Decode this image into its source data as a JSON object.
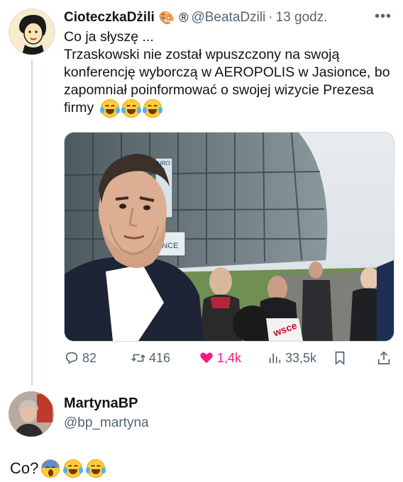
{
  "tweet": {
    "author_name": "CioteczkaDżili",
    "author_badges": [
      "🎨",
      "®"
    ],
    "handle": "@BeataDzili",
    "separator": "·",
    "time": "13 godz.",
    "more_icon": "more-dots-icon",
    "text": "Co ja słyszę ...\nTrzaskowski nie został wpuszczony na swoją konferencję wyborczą w AEROPOLIS w Jasionce, bo zapomniał poinformować o swojej wizycie Prezesa firmy",
    "text_emojis": [
      "😂",
      "😂",
      "😂"
    ],
    "media": {
      "sign_top": "URO\nNA",
      "sign_bottom": "DANCE",
      "mic_label": "wsce",
      "alt": "Rafał Trzaskowski przed halą"
    },
    "actions": {
      "replies": "82",
      "retweets": "416",
      "likes": "1,4k",
      "views": "33,5k"
    }
  },
  "reply": {
    "author_name": "MartynaBP",
    "handle": "@bp_martyna",
    "text": "Co?",
    "emojis": [
      "😱",
      "😂",
      "😂"
    ]
  },
  "colors": {
    "text": "#0f1419",
    "secondary": "#536471",
    "like": "#f91880",
    "thread_line": "#cfd9de"
  }
}
